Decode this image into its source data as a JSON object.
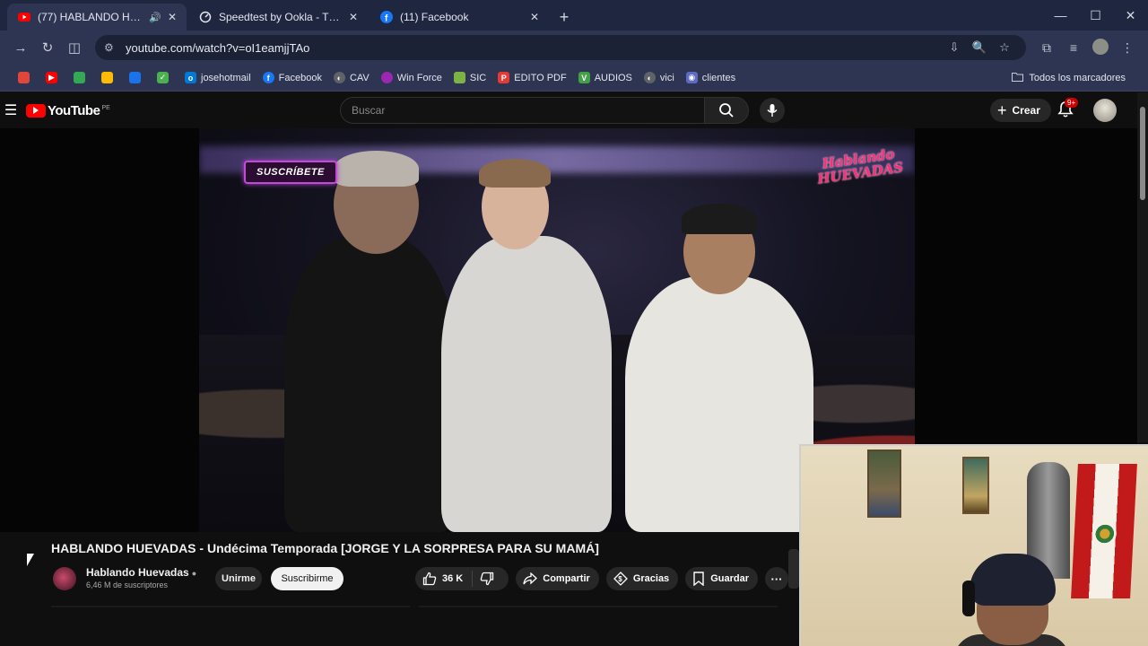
{
  "browser": {
    "tabs": [
      {
        "title": "(77) HABLANDO HUEVADAS",
        "active": true,
        "icon": "youtube-icon"
      },
      {
        "title": "Speedtest by Ookla - The Glob",
        "active": false,
        "icon": "speedtest-icon"
      },
      {
        "title": "(11) Facebook",
        "active": false,
        "icon": "facebook-icon"
      }
    ],
    "url": "youtube.com/watch?v=oI1eamjjTAo",
    "bookmarks": [
      {
        "label": "",
        "color": "#e0463a"
      },
      {
        "label": "",
        "color": "#ff0000"
      },
      {
        "label": "",
        "color": "#34a853"
      },
      {
        "label": "",
        "color": "#fbbc04"
      },
      {
        "label": "",
        "color": "#1a73e8"
      },
      {
        "label": "",
        "color": "#4caf50"
      },
      {
        "label": "josehotmail",
        "color": "#0078d4"
      },
      {
        "label": "Facebook",
        "color": "#1877f2"
      },
      {
        "label": "CAV",
        "color": "#5f6368"
      },
      {
        "label": "Win Force",
        "color": "#9c27b0"
      },
      {
        "label": "SIC",
        "color": "#7cb342"
      },
      {
        "label": "EDITO PDF",
        "color": "#e53935"
      },
      {
        "label": "AUDIOS",
        "color": "#43a047"
      },
      {
        "label": "vici",
        "color": "#5f6368"
      },
      {
        "label": "clientes",
        "color": "#5c6bc0"
      }
    ],
    "all_bookmarks": "Todos los marcadores"
  },
  "youtube": {
    "country": "PE",
    "logo_text": "YouTube",
    "search_placeholder": "Buscar",
    "create_label": "Crear",
    "notifications_badge": "9+",
    "video_overlay": {
      "subscribe_tag": "SUSCRÍBETE",
      "show_logo_line1": "Hablando",
      "show_logo_line2": "HUEVADAS"
    },
    "video_title": "HABLANDO HUEVADAS - Undécima Temporada [JORGE Y LA SORPRESA PARA SU MAMÁ]",
    "channel_name": "Hablando Huevadas",
    "subscribers": "6,46 M de suscriptores",
    "join_label": "Unirme",
    "subscribe_label": "Suscribirme",
    "likes": "36 K",
    "share_label": "Compartir",
    "thanks_label": "Gracias",
    "save_label": "Guardar"
  }
}
